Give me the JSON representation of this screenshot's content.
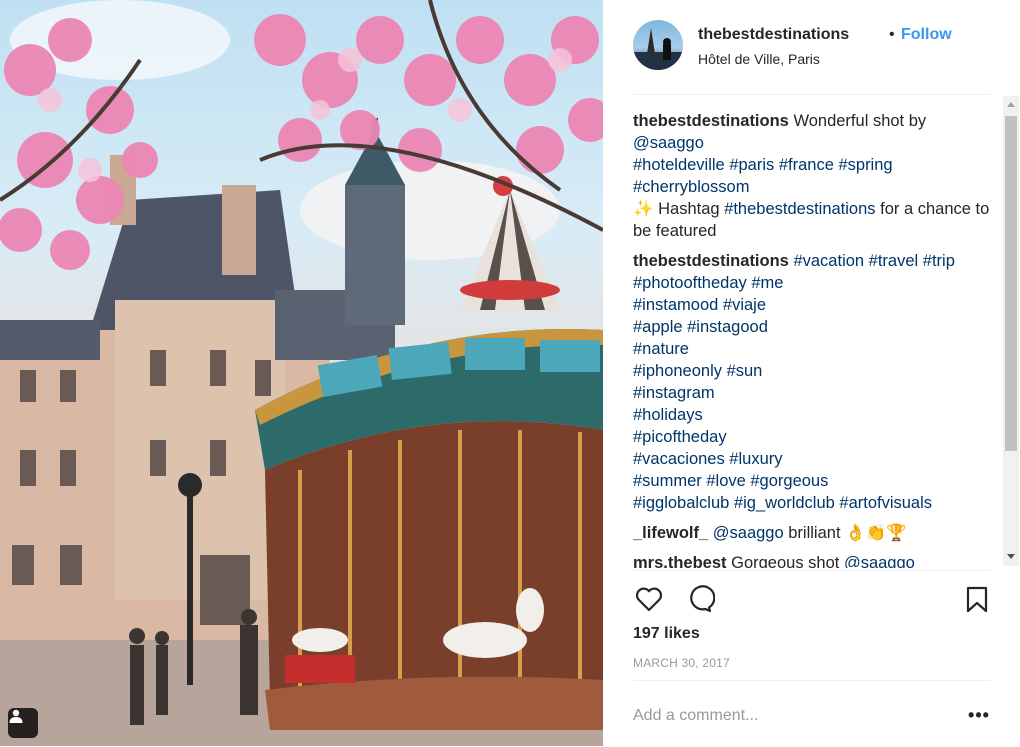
{
  "post": {
    "username": "thebestdestinations",
    "separator": "•",
    "follow_label": "Follow",
    "location": "Hôtel de Ville, Paris"
  },
  "comments": [
    {
      "author": "thebestdestinations",
      "text": "Wonderful shot by",
      "mention": "@saaggo",
      "tags_line1": "#hoteldeville #paris #france #spring",
      "tags_line2": "#cherryblossom",
      "emoji": "✨",
      "text2a": " Hashtag ",
      "tag2": "#thebestdestinations",
      "text2b": " for a chance to be featured"
    },
    {
      "author": "thebestdestinations",
      "first_tags": "#vacation #travel #trip",
      "tag_lines": [
        "#photooftheday #me",
        "#instamood #viaje",
        "#apple #instagood",
        "#nature",
        "#iphoneonly #sun",
        "#instagram",
        "#holidays",
        "#picoftheday",
        "#vacaciones #luxury",
        "#summer #love #gorgeous",
        "#igglobalclub #ig_worldclub #artofvisuals"
      ]
    },
    {
      "author": "_lifewolf_",
      "mention": "@saaggo",
      "text": " brilliant 👌👏🏆"
    },
    {
      "author": "mrs.thebest",
      "text": "Gorgeous shot ",
      "mention": "@saaggo"
    }
  ],
  "likes_text": "197 likes",
  "date_text": "MARCH 30, 2017",
  "add_comment_placeholder": "Add a comment...",
  "more_label": "•••",
  "icons": {
    "like": "heart-icon",
    "comment": "comment-bubble-icon",
    "save": "bookmark-icon",
    "user_tag": "user-tag-icon"
  },
  "colors": {
    "follow": "#3897f0",
    "hashtag": "#003569",
    "meta": "#999999",
    "text": "#262626"
  }
}
